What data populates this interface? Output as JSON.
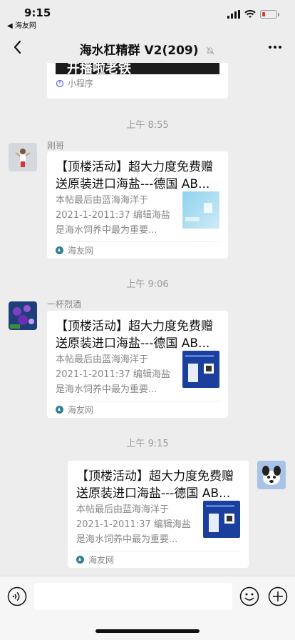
{
  "status": {
    "time": "9:15",
    "back_app": "◀ 海友网"
  },
  "nav": {
    "title": "海水杠精群 V2(209)"
  },
  "top_card": {
    "banner_text": "开播啦老铁",
    "mini_program_label": "小程序"
  },
  "messages": [
    {
      "timestamp": "上午 8:55",
      "sender": "刚哥",
      "title": "【顶楼活动】超大力度免费赠送原装进口海盐---德国 AB...",
      "desc": "本帖最后由蓝海海洋于 2021-1-2011:37 编辑海盐是海水饲养中最为重要...",
      "source": "海友网"
    },
    {
      "timestamp": "上午 9:06",
      "sender": "一杯烈酒",
      "title": "【顶楼活动】超大力度免费赠送原装进口海盐---德国 AB...",
      "desc": "本帖最后由蓝海海洋于 2021-1-2011:37 编辑海盐是海水饲养中最为重要...",
      "source": "海友网"
    },
    {
      "timestamp": "上午 9:15",
      "sender": "",
      "title": "【顶楼活动】超大力度免费赠送原装进口海盐---德国 AB...",
      "desc": "本帖最后由蓝海海洋于 2021-1-2011:37 编辑海盐是海水饲养中最为重要...",
      "source": "海友网"
    }
  ],
  "input": {
    "placeholder": ""
  },
  "colors": {
    "background": "#ededed",
    "card": "#ffffff",
    "muted_text": "#888888",
    "battery_low": "#e53935"
  }
}
